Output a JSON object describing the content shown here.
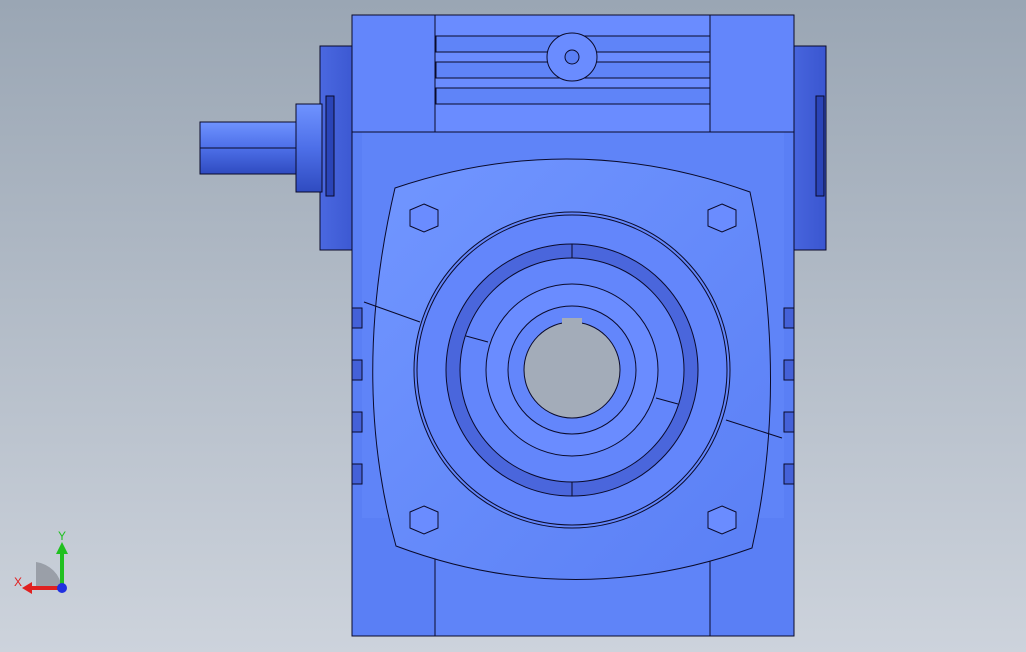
{
  "view": {
    "background_top": "#9aa6b4",
    "background_bottom": "#cdd3dc"
  },
  "model": {
    "body_color": "#5577ee",
    "face_color": "#6688ff",
    "shade_color": "#3a56d0",
    "edge_color": "#0a0a2a"
  },
  "triad": {
    "x_label": "X",
    "y_label": "Y",
    "x_color": "#e02020",
    "y_color": "#20c020",
    "z_color": "#2030e0"
  }
}
